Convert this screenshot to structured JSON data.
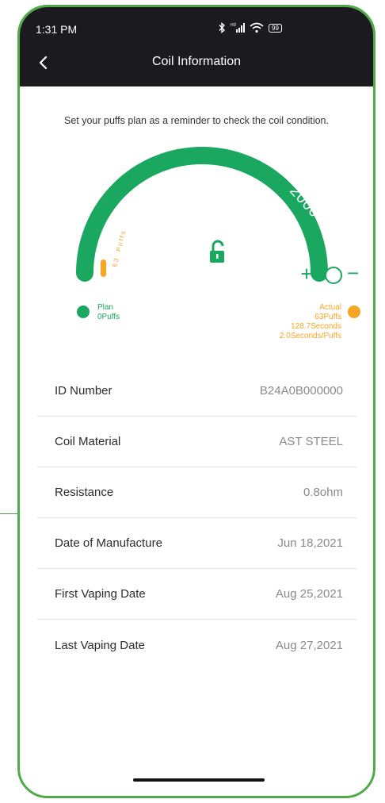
{
  "status_bar": {
    "time": "1:31 PM",
    "battery": "99"
  },
  "header": {
    "title": "Coil Information",
    "back_icon": "chevron-left-icon"
  },
  "hint": "Set your puffs plan as a reminder to check the coil condition.",
  "gauge": {
    "max_value": "2000",
    "max_unit": "Puffs",
    "actual_value": "63",
    "actual_unit": "Puffs",
    "plus_label": "+",
    "minus_label": "−",
    "lock_icon": "unlock-icon",
    "actual_fraction": 0.0315,
    "track_color": "#1aa760",
    "actual_color": "#f5a623"
  },
  "legend": {
    "plan_label": "Plan",
    "plan_value": "0Puffs",
    "actual_label": "Actual",
    "actual_puffs": "63Puffs",
    "actual_seconds": "128.7Seconds",
    "actual_rate": "2.0Seconds/Puffs"
  },
  "info": [
    {
      "label": "ID Number",
      "value": "B24A0B000000"
    },
    {
      "label": "Coil Material",
      "value": "AST STEEL"
    },
    {
      "label": "Resistance",
      "value": "0.8ohm"
    },
    {
      "label": "Date of Manufacture",
      "value": "Jun 18,2021"
    },
    {
      "label": "First Vaping Date",
      "value": "Aug 25,2021"
    },
    {
      "label": "Last Vaping Date",
      "value": "Aug 27,2021"
    }
  ],
  "colors": {
    "green": "#1aa760",
    "orange": "#f5a623",
    "topbar": "#1b1a1f",
    "frame": "#4faa4a"
  }
}
